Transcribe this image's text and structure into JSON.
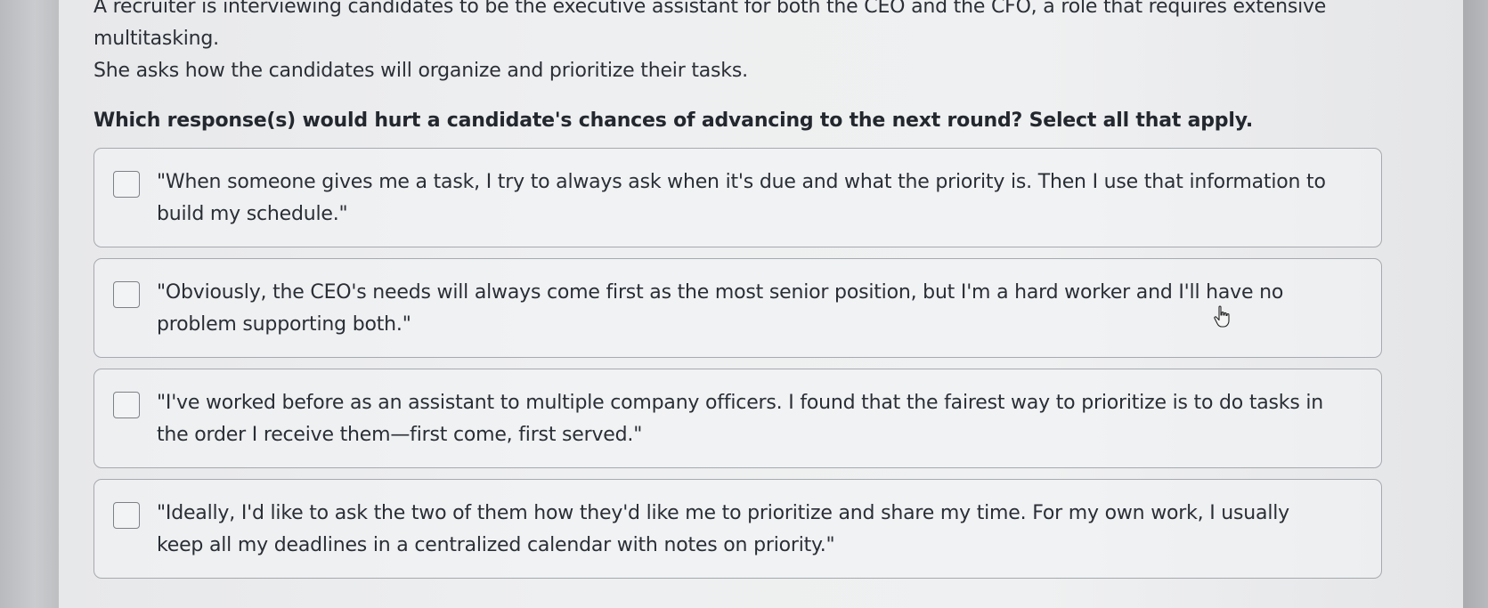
{
  "question": {
    "scenario_line1": "A recruiter is interviewing candidates to be the executive assistant for both the CEO and the CFO, a role that requires extensive multitasking.",
    "scenario_line2": "She asks how the candidates will organize and prioritize their tasks.",
    "prompt": "Which response(s) would hurt a candidate's chances of advancing to the next round? Select all that apply."
  },
  "options": [
    {
      "text": "\"When someone gives me a task, I try to always ask when it's due and what the priority is. Then I use that information to build my schedule.\"",
      "checked": false
    },
    {
      "text": "\"Obviously, the CEO's needs will always come first as the most senior position, but I'm a hard worker and I'll have no problem supporting both.\"",
      "checked": false
    },
    {
      "text": "\"I've worked before as an assistant to multiple company officers. I found that the fairest way to prioritize is to do tasks in the order I receive them—first come, first served.\"",
      "checked": false
    },
    {
      "text": "\"Ideally, I'd like to ask the two of them how they'd like me to prioritize and share my time. For my own work, I usually keep all my deadlines in a centralized calendar with notes on priority.\"",
      "checked": false
    }
  ],
  "icons": {
    "checkbox": "checkbox-unchecked-icon",
    "cursor": "hand-pointer-cursor-icon"
  },
  "colors": {
    "text": "#2b2f36",
    "border": "#a6a9ae",
    "background": "#eeeff0"
  }
}
